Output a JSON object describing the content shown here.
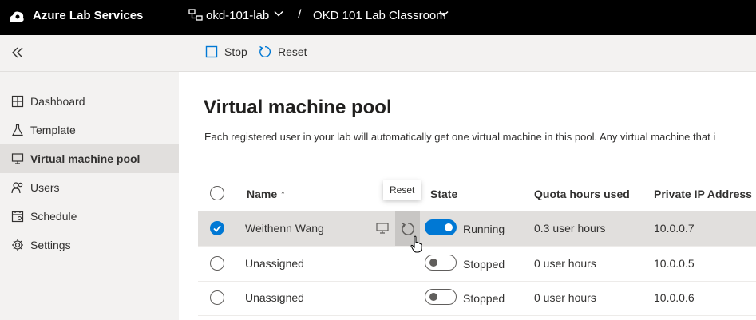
{
  "topbar": {
    "app_name": "Azure Lab Services",
    "lab_name": "okd-101-lab",
    "separator": "/",
    "classroom_name": "OKD 101 Lab Classroom"
  },
  "commands": {
    "stop_label": "Stop",
    "reset_label": "Reset"
  },
  "sidebar": {
    "items": [
      {
        "label": "Dashboard",
        "icon": "dashboard-icon"
      },
      {
        "label": "Template",
        "icon": "flask-icon"
      },
      {
        "label": "Virtual machine pool",
        "icon": "monitor-icon",
        "active": true
      },
      {
        "label": "Users",
        "icon": "users-icon"
      },
      {
        "label": "Schedule",
        "icon": "calendar-icon"
      },
      {
        "label": "Settings",
        "icon": "gear-icon"
      }
    ]
  },
  "main": {
    "title": "Virtual machine pool",
    "description": "Each registered user in your lab will automatically get one virtual machine in this pool. Any virtual machine that i"
  },
  "table": {
    "columns": {
      "name": "Name ↑",
      "state": "State",
      "quota": "Quota hours used",
      "ip": "Private IP Address"
    },
    "rows": [
      {
        "name": "Weithenn Wang",
        "state": "Running",
        "on": true,
        "quota": "0.3 user hours",
        "ip": "10.0.0.7",
        "selected": true
      },
      {
        "name": "Unassigned",
        "state": "Stopped",
        "on": false,
        "quota": "0 user hours",
        "ip": "10.0.0.5",
        "selected": false
      },
      {
        "name": "Unassigned",
        "state": "Stopped",
        "on": false,
        "quota": "0 user hours",
        "ip": "10.0.0.6",
        "selected": false
      }
    ]
  },
  "tooltip": {
    "text": "Reset"
  },
  "colors": {
    "accent": "#0078d4",
    "topbar": "#000000",
    "sidebar": "#f3f2f1"
  }
}
